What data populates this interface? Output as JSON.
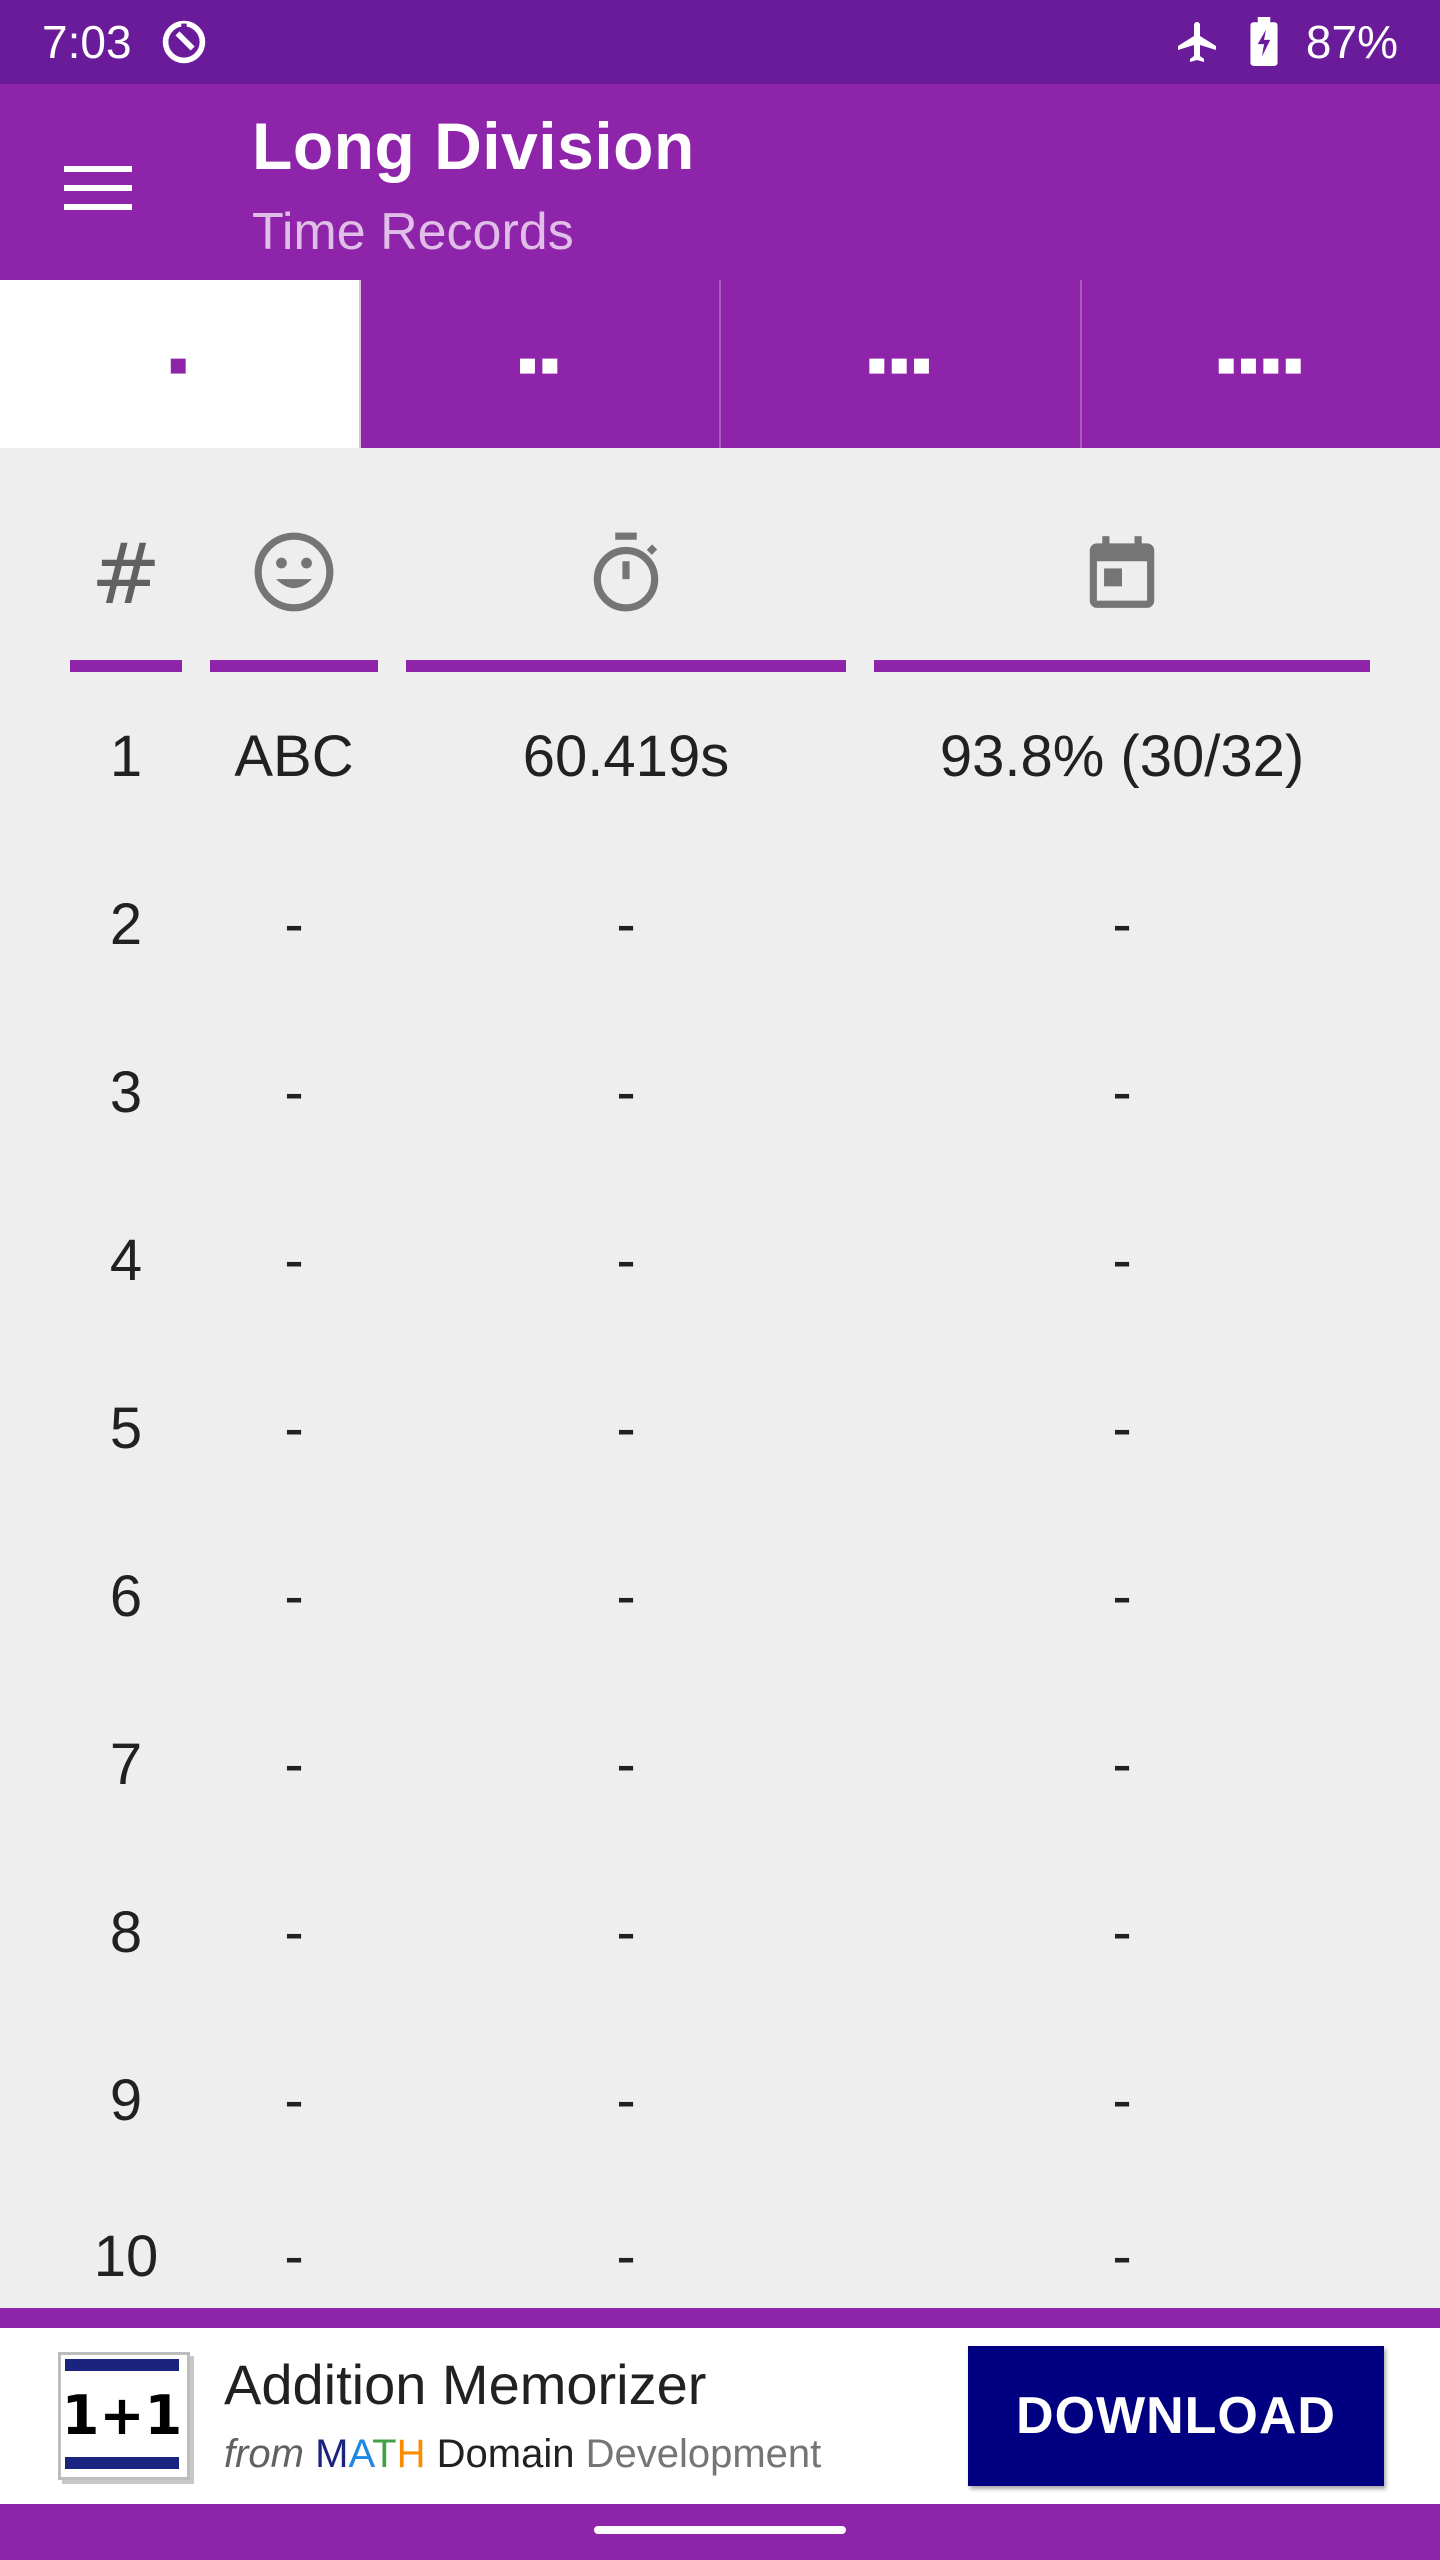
{
  "status_bar": {
    "time": "7:03",
    "battery": "87%",
    "icons": [
      "sync-icon",
      "airplane-mode-icon",
      "battery-charging-icon"
    ]
  },
  "app_bar": {
    "title": "Long Division",
    "subtitle": "Time Records",
    "menu_icon": "hamburger-menu-icon"
  },
  "tabs": [
    {
      "label": "▪",
      "selected": true
    },
    {
      "label": "▪▪",
      "selected": false
    },
    {
      "label": "▪▪▪",
      "selected": false
    },
    {
      "label": "▪▪▪▪",
      "selected": false
    }
  ],
  "table": {
    "headers": {
      "rank": "#",
      "name_icon": "smiley-face-icon",
      "time_icon": "stopwatch-icon",
      "date_icon": "calendar-icon"
    },
    "rows": [
      {
        "rank": "1",
        "name": "ABC",
        "time": "60.419s",
        "score": "93.8% (30/32)"
      },
      {
        "rank": "2",
        "name": "-",
        "time": "-",
        "score": "-"
      },
      {
        "rank": "3",
        "name": "-",
        "time": "-",
        "score": "-"
      },
      {
        "rank": "4",
        "name": "-",
        "time": "-",
        "score": "-"
      },
      {
        "rank": "5",
        "name": "-",
        "time": "-",
        "score": "-"
      },
      {
        "rank": "6",
        "name": "-",
        "time": "-",
        "score": "-"
      },
      {
        "rank": "7",
        "name": "-",
        "time": "-",
        "score": "-"
      },
      {
        "rank": "8",
        "name": "-",
        "time": "-",
        "score": "-"
      },
      {
        "rank": "9",
        "name": "-",
        "time": "-",
        "score": "-"
      },
      {
        "rank": "10",
        "name": "-",
        "time": "-",
        "score": "-"
      }
    ]
  },
  "ad": {
    "icon_text": "1+1",
    "title": "Addition Memorizer",
    "from": "from",
    "brand_letters": [
      {
        "char": "M",
        "color": "#1a237e"
      },
      {
        "char": "A",
        "color": "#1e88e5"
      },
      {
        "char": "T",
        "color": "#43a047"
      },
      {
        "char": "H",
        "color": "#fb8c00"
      }
    ],
    "domain": "Domain",
    "development": "Development",
    "cta": "DOWNLOAD"
  },
  "colors": {
    "primary": "#8e24aa",
    "primary_dark": "#6a1b9a",
    "cta_bg": "#000080",
    "background": "#eeeeee"
  }
}
